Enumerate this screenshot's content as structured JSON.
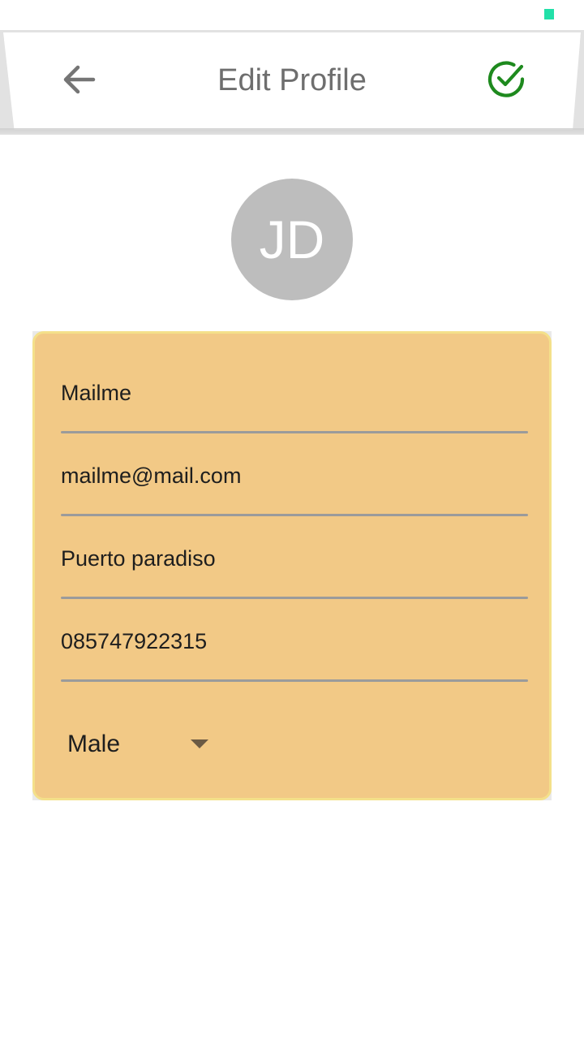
{
  "header": {
    "title": "Edit Profile",
    "back_icon": "arrow-left-icon",
    "save_icon": "check-circle-icon",
    "save_color": "#1e8a1e"
  },
  "avatar": {
    "initials": "JD",
    "color": "#bdbdbd"
  },
  "form": {
    "name": "Mailme",
    "email": "mailme@mail.com",
    "address": "Puerto paradiso",
    "phone": "085747922315",
    "gender": "Male",
    "card_color": "#f2c986"
  }
}
